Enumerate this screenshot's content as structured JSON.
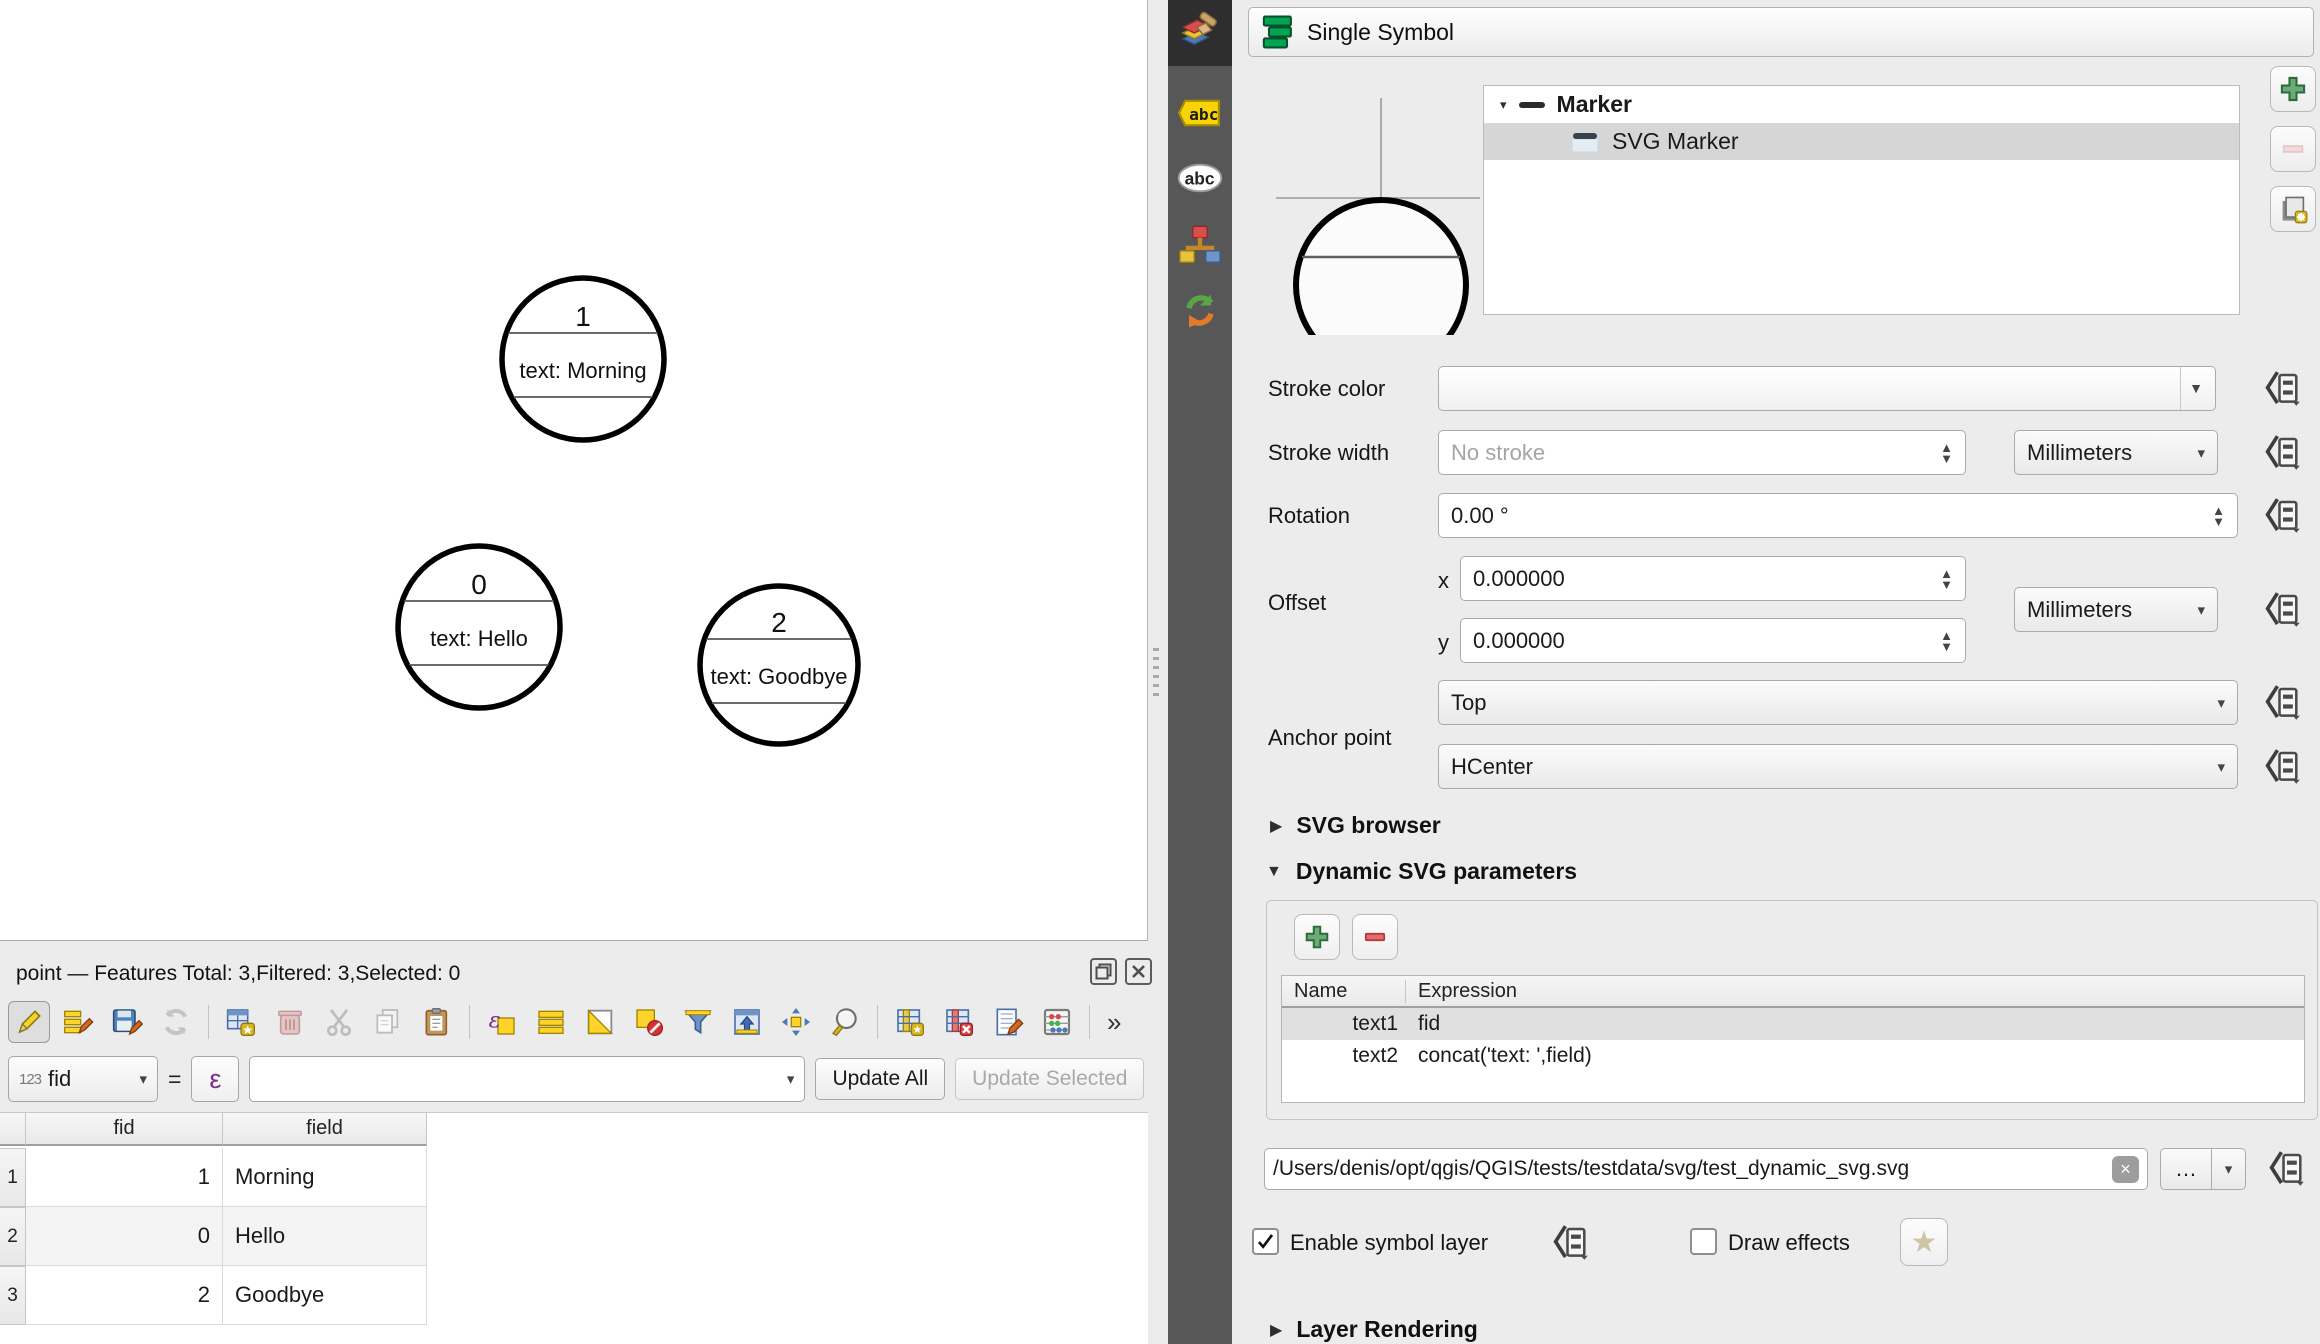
{
  "glyphs": {
    "chevron_down": "▾",
    "spin_up": "▲",
    "spin_down": "▼",
    "triangle_right": "▶",
    "triangle_down": "▼",
    "tree_expanded": "▾",
    "close": "×",
    "star": "★",
    "overflow": "»"
  },
  "colors": {
    "accent_green": "#00a651",
    "dock_strip": "#575757",
    "selection_gray": "#d6d6d6",
    "disabled_text": "#a9a9a9"
  },
  "map": {
    "features": [
      {
        "fid": "1",
        "label": "text: Morning"
      },
      {
        "fid": "0",
        "label": "text: Hello"
      },
      {
        "fid": "2",
        "label": "text: Goodbye"
      }
    ]
  },
  "attribute_table": {
    "title": "point — Features Total: 3,Filtered: 3,Selected: 0",
    "toolbar": {
      "icons": [
        "toggle-editing",
        "multiedit",
        "save-edits",
        "reload",
        "add-feature",
        "delete-selected",
        "cut",
        "copy",
        "paste",
        "select-by-expression",
        "select-all",
        "invert-selection",
        "deselect-all",
        "filter-select",
        "move-selection-to-top",
        "pan-to-selection",
        "zoom-to-selection",
        "new-field",
        "delete-field",
        "edit-fields",
        "field-calculator"
      ]
    },
    "field_combo": {
      "type_badge": "123",
      "field": "fid"
    },
    "equals": "=",
    "expression_button": "ε",
    "expression_value": "",
    "update_all": "Update All",
    "update_selected": "Update Selected",
    "columns": {
      "fid": "fid",
      "field": "field"
    },
    "rows": [
      {
        "n": "1",
        "fid": "1",
        "field": "Morning"
      },
      {
        "n": "2",
        "fid": "0",
        "field": "Hello"
      },
      {
        "n": "3",
        "fid": "2",
        "field": "Goodbye"
      }
    ]
  },
  "styling_dock": {
    "tabs": [
      "symbology",
      "labels",
      "masks",
      "styles",
      "history"
    ],
    "header": {
      "title": "Single Symbol"
    },
    "symbol_tree": {
      "root": "Marker",
      "child": "SVG Marker"
    },
    "form": {
      "stroke_color_label": "Stroke color",
      "stroke_width_label": "Stroke width",
      "stroke_width_placeholder": "No stroke",
      "stroke_width_unit": "Millimeters",
      "rotation_label": "Rotation",
      "rotation_value": "0.00 °",
      "offset_label": "Offset",
      "offset_x_label": "x",
      "offset_x_value": "0.000000",
      "offset_y_label": "y",
      "offset_y_value": "0.000000",
      "offset_unit": "Millimeters",
      "anchor_label": "Anchor point",
      "anchor_vertical": "Top",
      "anchor_horizontal": "HCenter"
    },
    "sections": {
      "svg_browser": "SVG browser",
      "dynamic_svg": "Dynamic SVG parameters",
      "layer_rendering": "Layer Rendering"
    },
    "dynamic_svg_parameters": {
      "columns": {
        "name": "Name",
        "expression": "Expression"
      },
      "rows": [
        {
          "name": "text1",
          "expression": "fid"
        },
        {
          "name": "text2",
          "expression": "concat('text: ',field)"
        }
      ]
    },
    "svg_path": "/Users/denis/opt/qgis/QGIS/tests/testdata/svg/test_dynamic_svg.svg",
    "browse_button": "…",
    "enable_symbol_layer_label": "Enable symbol layer",
    "draw_effects_label": "Draw effects"
  }
}
